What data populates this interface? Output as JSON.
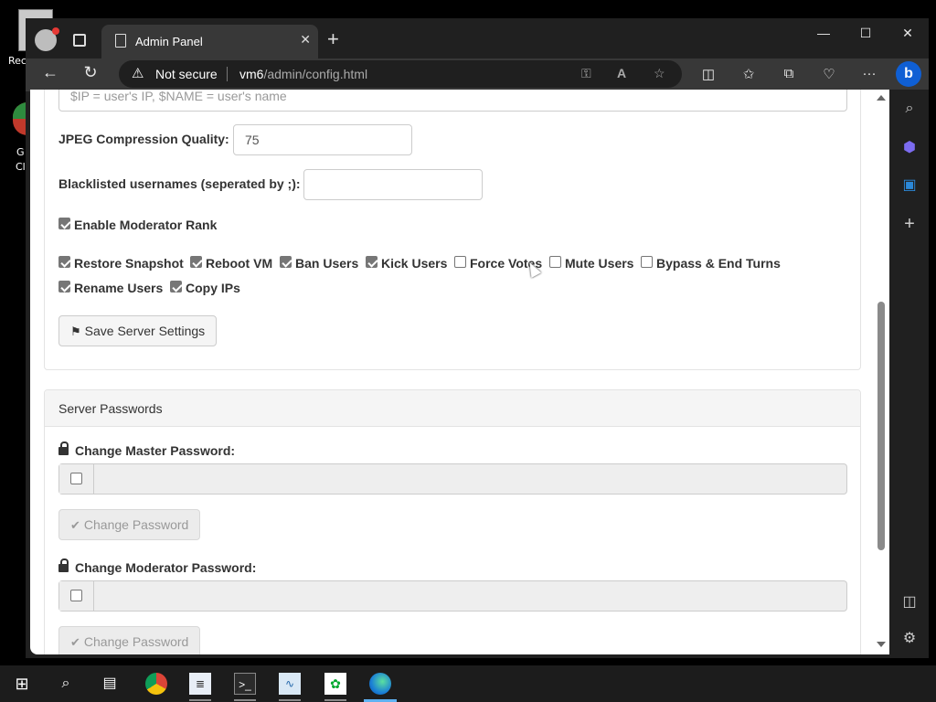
{
  "desktop": {
    "icon1_label": "Rec",
    "icon2_label_a": "G",
    "icon2_label_b": "Cl"
  },
  "browser": {
    "tab_title": "Admin Panel",
    "tab_icon": "document-icon",
    "new_tab": "+",
    "window_controls": {
      "minimize": "—",
      "maximize": "☐",
      "close": "✕"
    },
    "address": {
      "security_label": "Not secure",
      "host": "vm6",
      "path": "/admin/config.html"
    }
  },
  "config": {
    "motd_placeholder": "$IP = user's IP, $NAME = user's name",
    "jpeg_label": "JPEG Compression Quality:",
    "jpeg_value": "75",
    "blacklist_label": "Blacklisted usernames (seperated by ;):",
    "blacklist_value": "",
    "enable_mod_rank": {
      "label": "Enable Moderator Rank",
      "checked": true
    },
    "permissions": [
      {
        "label": "Restore Snapshot",
        "checked": true
      },
      {
        "label": "Reboot VM",
        "checked": true
      },
      {
        "label": "Ban Users",
        "checked": true
      },
      {
        "label": "Kick Users",
        "checked": true
      },
      {
        "label": "Force Votes",
        "checked": false
      },
      {
        "label": "Mute Users",
        "checked": false
      },
      {
        "label": "Bypass & End Turns",
        "checked": false
      },
      {
        "label": "Rename Users",
        "checked": true
      },
      {
        "label": "Copy IPs",
        "checked": true
      }
    ],
    "save_button": "Save Server Settings"
  },
  "passwords": {
    "title": "Server Passwords",
    "master_label": "Change Master Password:",
    "master_checked": false,
    "master_button": "Change Password",
    "mod_label": "Change Moderator Password:",
    "mod_checked": false,
    "mod_button": "Change Password"
  },
  "taskbar": {
    "items": [
      "windows-start-icon",
      "search-icon",
      "task-view-icon",
      "chrome-icon",
      "notepad-icon",
      "terminal-icon",
      "performance-monitor-icon",
      "evernote-icon",
      "edge-icon"
    ]
  }
}
